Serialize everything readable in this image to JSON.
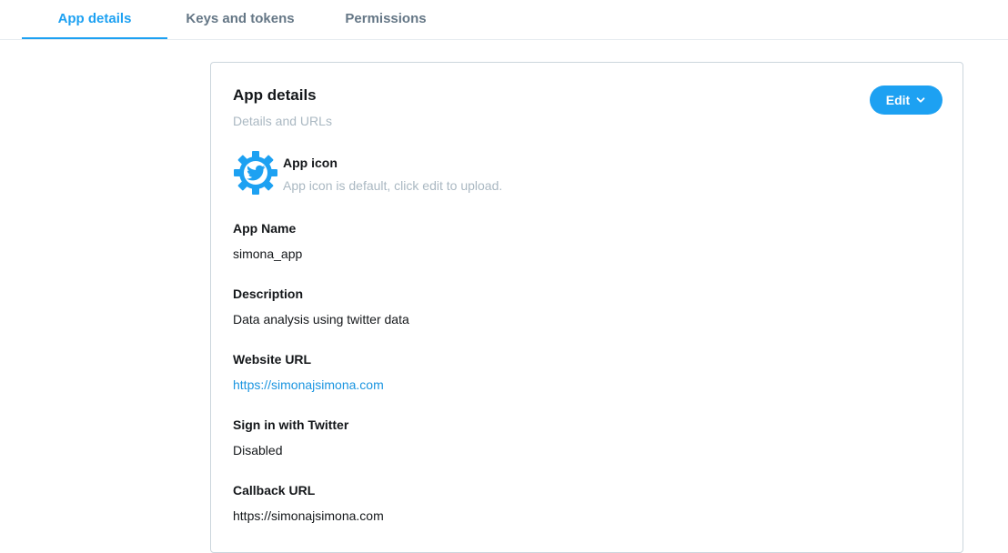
{
  "tabs": [
    {
      "label": "App details",
      "active": true
    },
    {
      "label": "Keys and tokens",
      "active": false
    },
    {
      "label": "Permissions",
      "active": false
    }
  ],
  "card": {
    "title": "App details",
    "subtitle": "Details and URLs",
    "edit_label": "Edit",
    "app_icon": {
      "icon": "twitter-gear-icon",
      "label": "App icon",
      "description": "App icon is default, click edit to upload."
    },
    "fields": [
      {
        "label": "App Name",
        "value": "simona_app"
      },
      {
        "label": "Description",
        "value": "Data analysis using twitter data"
      },
      {
        "label": "Website URL",
        "value": "https://simonajsimona.com"
      },
      {
        "label": "Sign in with Twitter",
        "value": "Disabled"
      },
      {
        "label": "Callback URL",
        "value": "https://simonajsimona.com"
      }
    ]
  },
  "colors": {
    "accent": "#1da1f2",
    "link": "#1b95e0",
    "muted": "#aab8c2",
    "tab_inactive": "#657786"
  }
}
